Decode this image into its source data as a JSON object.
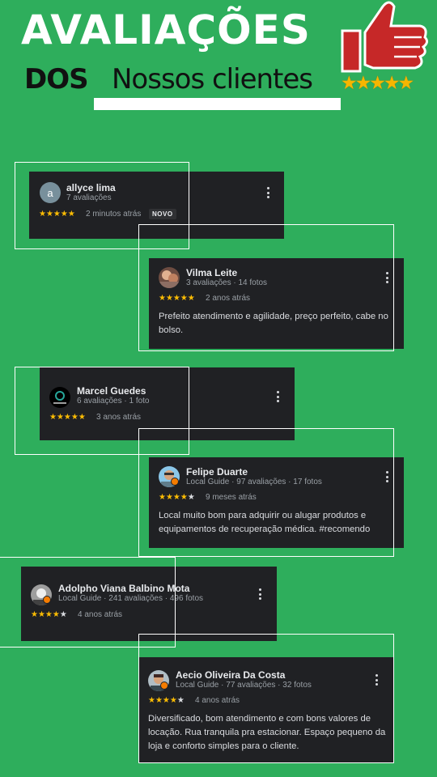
{
  "header": {
    "title": "AVALIAÇÕES",
    "dos": "DOS",
    "subtitle": "Nossos clientes",
    "rating_stars": "★★★★★"
  },
  "icons": {
    "thumb": "thumbs-up-icon",
    "star": "star-icon",
    "menu": "more-vert-icon",
    "badge": "local-guide-badge-icon"
  },
  "colors": {
    "background": "#2eae5c",
    "card": "#202124",
    "star": "#fbbc04",
    "thumb": "#c62828"
  },
  "reviews": [
    {
      "avatar_letter": "a",
      "name": "allyce lima",
      "meta": "7 avaliações",
      "stars_on": "★★★★★",
      "stars_off": "",
      "time": "2 minutos atrás",
      "tag": "NOVO",
      "text": ""
    },
    {
      "name": "Vilma Leite",
      "meta": "3 avaliações · 14 fotos",
      "stars_on": "★★★★★",
      "stars_off": "",
      "time": "2 anos atrás",
      "text": "Prefeito atendimento e agilidade, preço perfeito, cabe no bolso."
    },
    {
      "name": "Marcel Guedes",
      "meta": "6 avaliações · 1 foto",
      "stars_on": "★★★★★",
      "stars_off": "",
      "time": "3 anos atrás",
      "text": ""
    },
    {
      "name": "Felipe Duarte",
      "meta": "Local Guide · 97 avaliações · 17 fotos",
      "stars_on": "★★★★",
      "stars_off": "★",
      "time": "9 meses atrás",
      "text": "Local muito bom para adquirir ou alugar produtos e equipamentos de recuperação médica. #recomendo"
    },
    {
      "name": "Adolpho Viana Balbino Mota",
      "meta": "Local Guide · 241 avaliações · 496 fotos",
      "stars_on": "★★★★",
      "stars_off": "★",
      "time": "4 anos atrás",
      "text": ""
    },
    {
      "name": "Aecio Oliveira Da Costa",
      "meta": "Local Guide · 77 avaliações · 32 fotos",
      "stars_on": "★★★★",
      "stars_off": "★",
      "time": "4 anos atrás",
      "text": "Diversificado, bom atendimento e com bons valores de locação. Rua tranquila pra estacionar. Espaço pequeno da loja e conforto simples para o cliente."
    }
  ]
}
